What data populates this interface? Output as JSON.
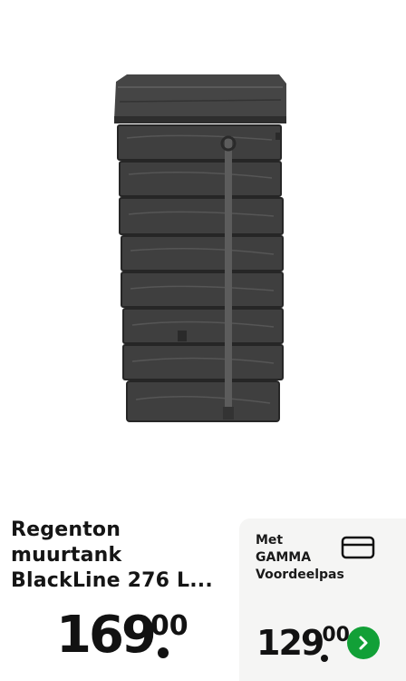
{
  "product": {
    "title": "Regenton\nmuurtank\nBlackLine 276 L...",
    "price_int": "169",
    "price_dec": "00",
    "image_icon": "rain-barrel-image"
  },
  "card_offer": {
    "label": "Met\nGAMMA\nVoordeelpas",
    "price_int": "129",
    "price_dec": "00",
    "card_icon": "credit-card-icon",
    "next_icon": "chevron-right-icon"
  },
  "colors": {
    "accent": "#12a037",
    "panel": "#f5f5f4",
    "tank": "#3f3f3f"
  }
}
